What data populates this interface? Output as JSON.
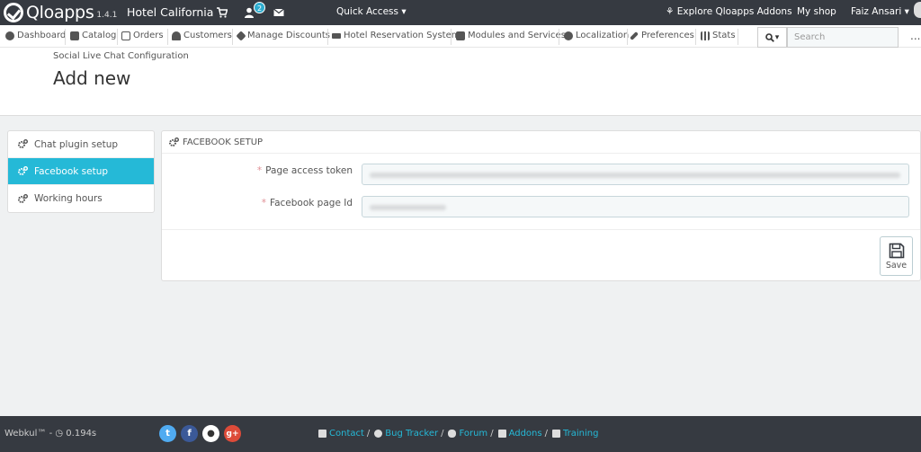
{
  "topbar": {
    "brand": "Qloapps",
    "version": "1.4.1",
    "shop_name": "Hotel California",
    "notification_count": "2",
    "quick_access": "Quick Access",
    "explore": "Explore Qloapps Addons",
    "my_shop": "My shop",
    "user": "Faiz Ansari"
  },
  "nav": {
    "items": [
      {
        "label": "Dashboard",
        "icon": "dashboard-icon"
      },
      {
        "label": "Catalog",
        "icon": "book-icon"
      },
      {
        "label": "Orders",
        "icon": "credit-card-icon"
      },
      {
        "label": "Customers",
        "icon": "users-icon"
      },
      {
        "label": "Manage Discounts",
        "icon": "tags-icon"
      },
      {
        "label": "Hotel Reservation System",
        "icon": "bed-icon"
      },
      {
        "label": "Modules and Services",
        "icon": "puzzle-icon"
      },
      {
        "label": "Localization",
        "icon": "globe-icon"
      },
      {
        "label": "Preferences",
        "icon": "wrench-icon"
      },
      {
        "label": "Stats",
        "icon": "bar-chart-icon"
      }
    ],
    "search_placeholder": "Search",
    "more": "..."
  },
  "header": {
    "breadcrumb": "Social Live Chat Configuration",
    "title": "Add new"
  },
  "sidebar": {
    "items": [
      {
        "label": "Chat plugin setup",
        "active": false
      },
      {
        "label": "Facebook setup",
        "active": true
      },
      {
        "label": "Working hours",
        "active": false
      }
    ]
  },
  "panel": {
    "title": "FACEBOOK SETUP",
    "fields": [
      {
        "label": "Page access token",
        "required": true
      },
      {
        "label": "Facebook page Id",
        "required": true
      }
    ],
    "save_label": "Save"
  },
  "footer": {
    "left": "Webkul™ - ",
    "time": "0.194s",
    "links": [
      "Contact",
      "Bug Tracker",
      "Forum",
      "Addons",
      "Training"
    ]
  },
  "colors": {
    "topbar_bg": "#363a41",
    "accent": "#25b9d7",
    "badge": "#2eacce"
  }
}
